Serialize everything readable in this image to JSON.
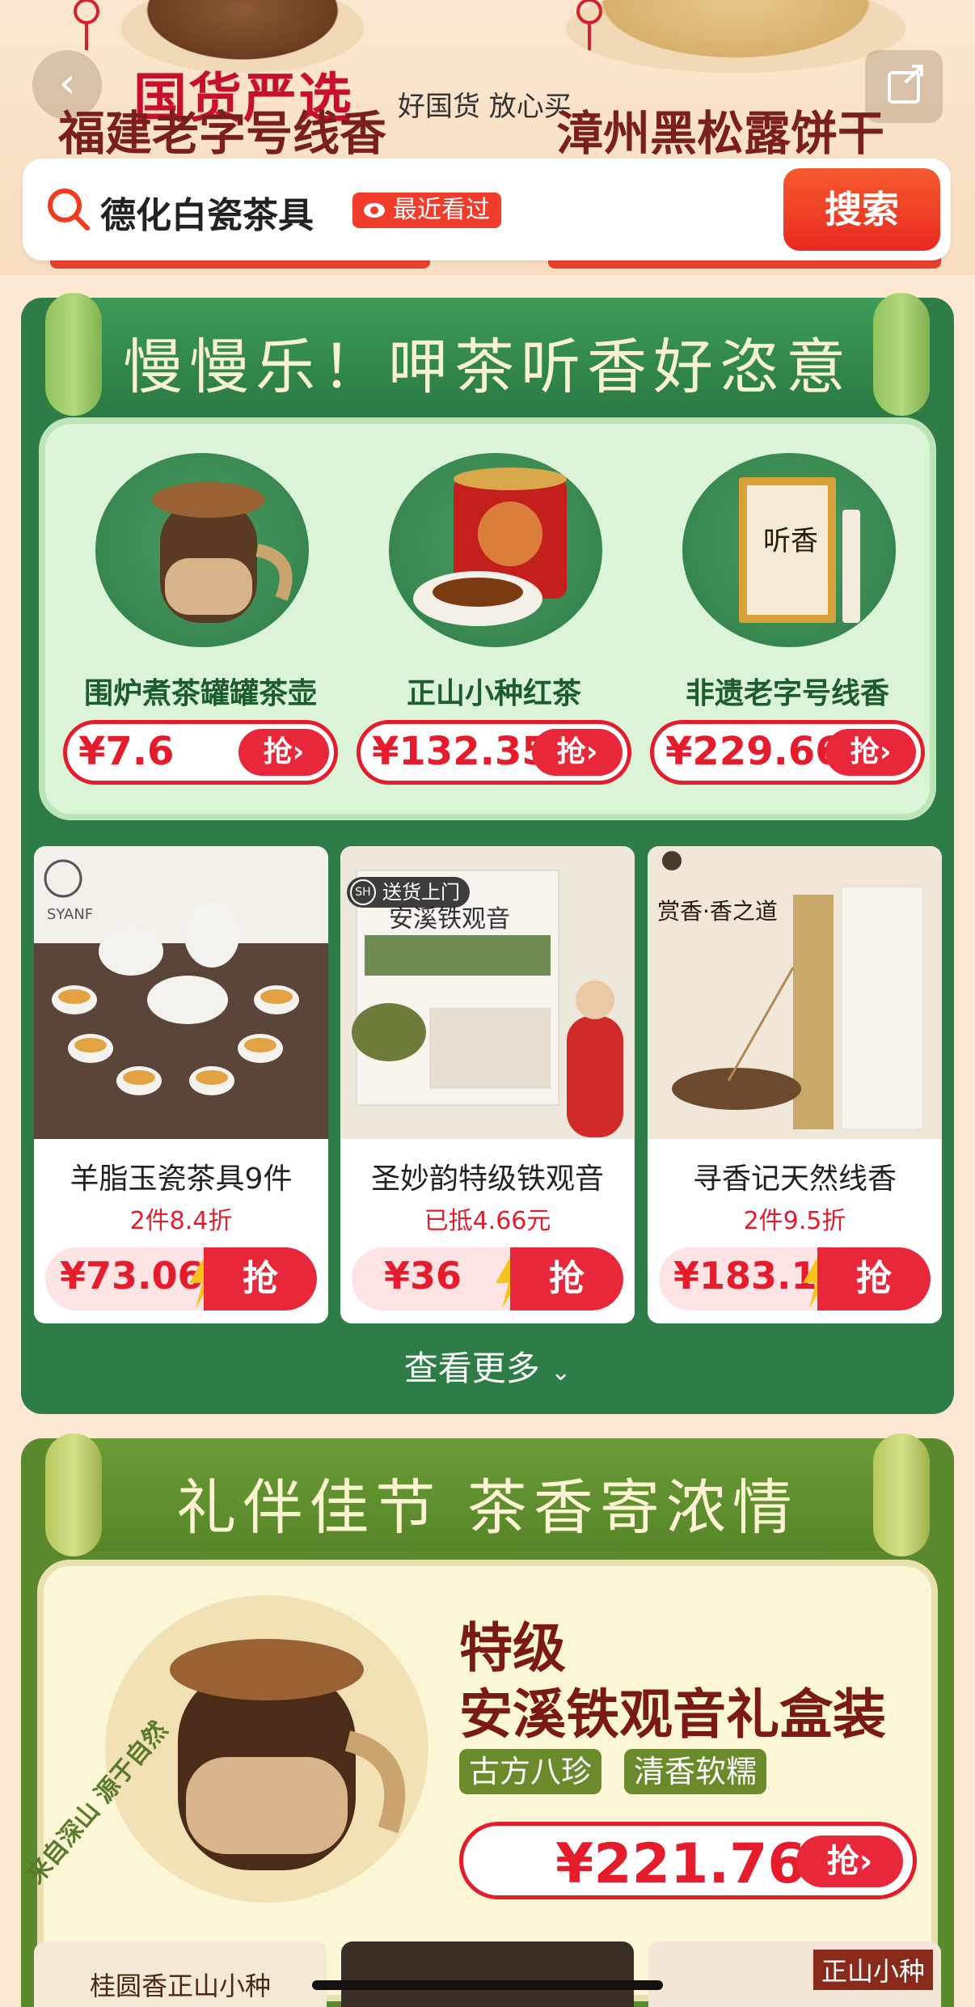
{
  "header": {
    "brand_title": "国货严选",
    "brand_sub": "好国货 放心买",
    "left_label": "福建老字号线香",
    "right_label": "漳州黑松露饼干",
    "back_icon": "chevron-left-icon",
    "share_icon": "share-icon"
  },
  "search": {
    "query": "德化白瓷茶具",
    "badge": "最近看过",
    "button": "搜索"
  },
  "section1": {
    "title": "慢慢乐！呷茶听香好恣意",
    "featured": [
      {
        "name": "围炉煮茶罐罐茶壶",
        "price": "¥7.6",
        "grab": "抢"
      },
      {
        "name": "正山小种红茶",
        "price": "¥132.35",
        "grab": "抢"
      },
      {
        "name": "非遗老字号线香",
        "price": "¥229.66",
        "grab": "抢"
      }
    ],
    "products": [
      {
        "name": "羊脂玉瓷茶具9件",
        "promo": "2件8.4折",
        "price": "¥73.06",
        "grab": "抢",
        "brand": "SYANF"
      },
      {
        "name": "圣妙韵特级铁观音",
        "promo": "已抵4.66元",
        "price": "¥36",
        "grab": "抢",
        "badge": "送货上门",
        "badge_logo": "SH",
        "img_text": "安溪铁观音"
      },
      {
        "name": "寻香记天然线香",
        "promo": "2件9.5折",
        "price": "¥183.16",
        "grab": "抢",
        "img_text": "赏香·香之道"
      }
    ],
    "see_more": "查看更多"
  },
  "section2": {
    "title": "礼伴佳节 茶香寄浓情",
    "arc_text": "来自深山 源于自然",
    "product_line1": "特级",
    "product_line2": "安溪铁观音礼盒装",
    "tags": [
      "古方八珍",
      "清香软糯"
    ],
    "price": "¥221.76",
    "grab": "抢"
  },
  "peek": [
    "桂圆香正山小种",
    "",
    "正山小种"
  ],
  "colors": {
    "accent_red": "#e41c2c",
    "section1_green": "#2e7d46",
    "section2_green": "#5b8a2e"
  }
}
